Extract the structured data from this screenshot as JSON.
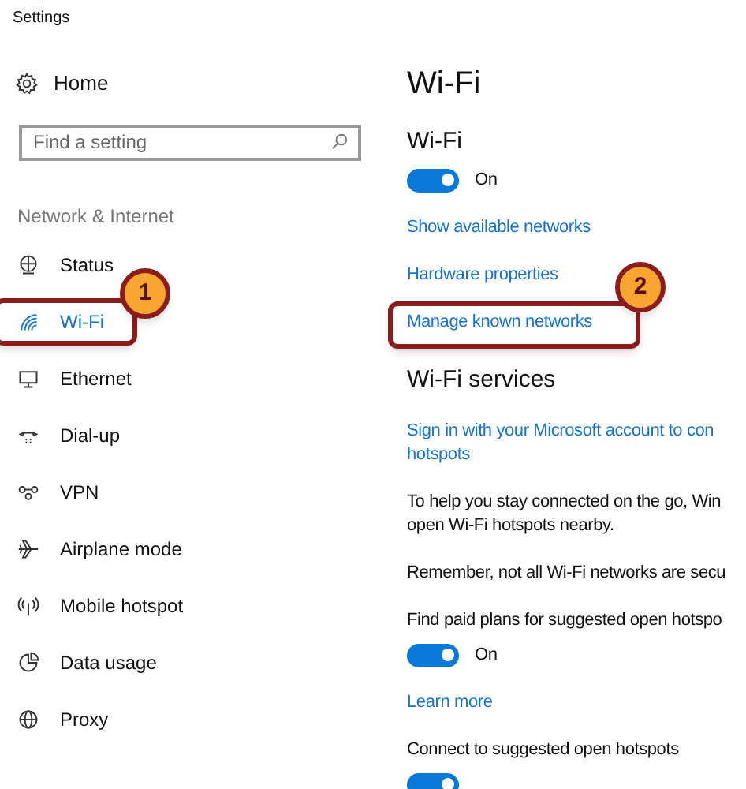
{
  "window": {
    "title": "Settings"
  },
  "sidebar": {
    "home": "Home",
    "search": {
      "placeholder": "Find a setting"
    },
    "section": "Network & Internet",
    "items": [
      {
        "label": "Status",
        "kind": "status",
        "selected": false
      },
      {
        "label": "Wi-Fi",
        "kind": "wifi",
        "selected": true
      },
      {
        "label": "Ethernet",
        "kind": "ethernet",
        "selected": false
      },
      {
        "label": "Dial-up",
        "kind": "dialup",
        "selected": false
      },
      {
        "label": "VPN",
        "kind": "vpn",
        "selected": false
      },
      {
        "label": "Airplane mode",
        "kind": "airplane",
        "selected": false
      },
      {
        "label": "Mobile hotspot",
        "kind": "hotspot",
        "selected": false
      },
      {
        "label": "Data usage",
        "kind": "data",
        "selected": false
      },
      {
        "label": "Proxy",
        "kind": "proxy",
        "selected": false
      }
    ]
  },
  "main": {
    "title": "Wi-Fi",
    "blocks": [
      {
        "kind": "heading",
        "text": "Wi-Fi"
      },
      {
        "kind": "toggle",
        "on": true,
        "label": "On"
      },
      {
        "kind": "link",
        "text": "Show available networks"
      },
      {
        "kind": "link",
        "text": "Hardware properties"
      },
      {
        "kind": "link",
        "text": "Manage known networks"
      },
      {
        "kind": "heading",
        "text": "Wi-Fi services"
      },
      {
        "kind": "link",
        "text": "Sign in with your Microsoft account to con\nhotspots"
      },
      {
        "kind": "text",
        "text": "To help you stay connected on the go, Win\nopen Wi-Fi hotspots nearby."
      },
      {
        "kind": "text",
        "text": "Remember, not all Wi-Fi networks are secu"
      },
      {
        "kind": "text",
        "text": "Find paid plans for suggested open hotspo"
      },
      {
        "kind": "toggle",
        "on": true,
        "label": "On"
      },
      {
        "kind": "link",
        "text": "Learn more"
      },
      {
        "kind": "text",
        "text": "Connect to suggested open hotspots"
      },
      {
        "kind": "toggle",
        "on": true
      }
    ]
  },
  "callouts": [
    {
      "number": "1"
    },
    {
      "number": "2"
    }
  ]
}
